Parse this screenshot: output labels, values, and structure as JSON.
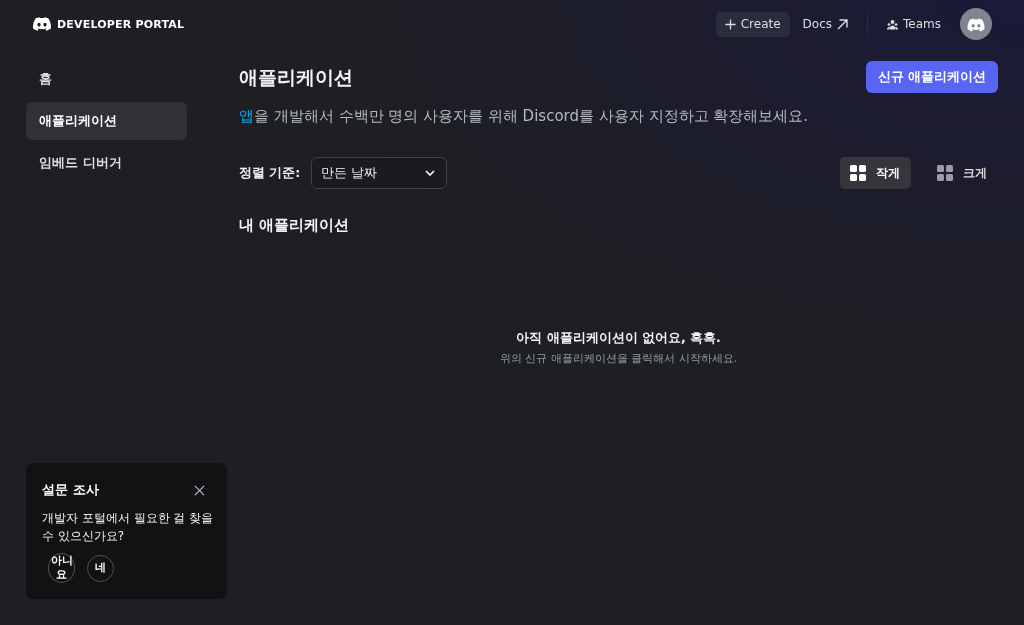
{
  "header": {
    "logo_text": "DEVELOPER PORTAL",
    "actions": [
      {
        "label": "Create",
        "kind": "create"
      },
      {
        "label": "Docs",
        "kind": "docs"
      },
      {
        "label": "Teams",
        "kind": "teams"
      }
    ]
  },
  "sidebar": {
    "items": [
      {
        "label": "홈",
        "selected": false
      },
      {
        "label": "애플리케이션",
        "selected": true
      },
      {
        "label": "임베드 디버거",
        "selected": false
      }
    ]
  },
  "page": {
    "title": "애플리케이션",
    "new_button": "신규 애플리케이션",
    "subtitle_link": "앱",
    "subtitle": "을 개발해서 수백만 명의 사용자를 위해 Discord를 사용자 지정하고 확장해보세요."
  },
  "sort": {
    "label": "정렬 기준:",
    "value": "만든 날짜"
  },
  "view_toggle": [
    {
      "label": "작게",
      "selected": true
    },
    {
      "label": "크게",
      "selected": false
    }
  ],
  "section_title": "내 애플리케이션",
  "empty_state": {
    "title": "아직 애플리케이션이 없어요, 흑흑.",
    "hint": "위의 신규 애플리케이션을 클릭해서 시작하세요."
  },
  "survey": {
    "title": "설문 조사",
    "question": "개발자 포털에서 필요한 걸 찾을 수 있으신가요?",
    "answers": [
      "아니요",
      "네"
    ]
  }
}
